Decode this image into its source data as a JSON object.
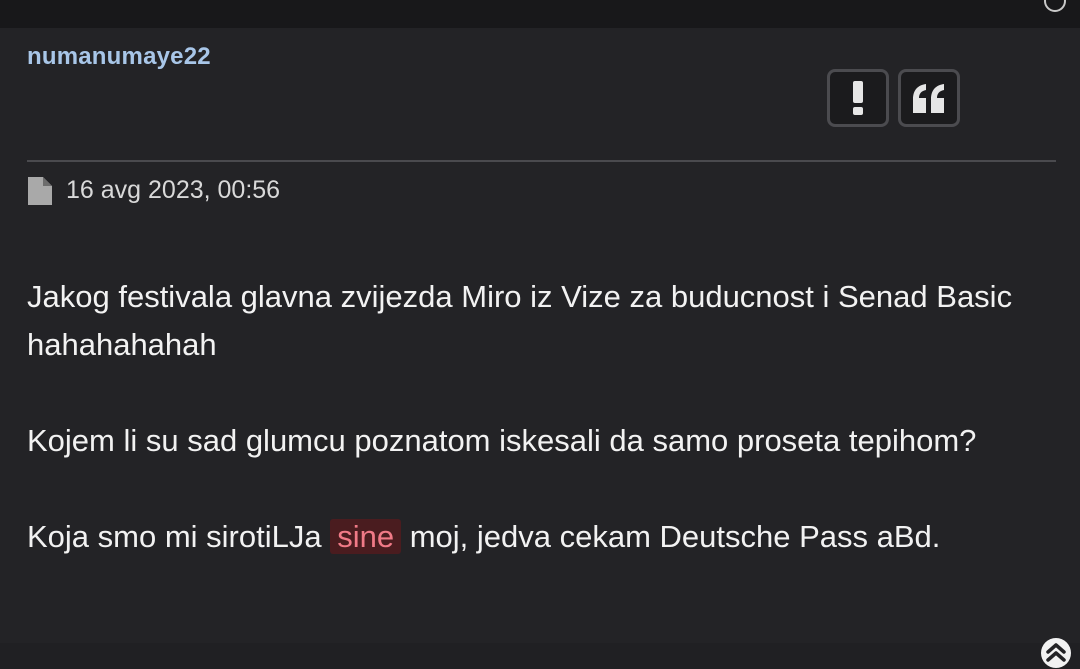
{
  "post": {
    "author": "numanumaye22",
    "timestamp": "16 avg 2023, 00:56",
    "actions": {
      "report_icon": "exclamation-icon",
      "quote_icon": "quote-icon"
    },
    "paragraphs": [
      "Jakog festivala glavna zvijezda Miro iz Vize za buducnost i Senad Basic hahahahahah",
      "Kojem li su sad glumcu poznatom iskesali da samo proseta tepihom?"
    ],
    "last_paragraph": {
      "before": "Koja smo mi sirotiLJa ",
      "highlight": "sine",
      "after": " moj, jedva cekam Deutsche Pass aBd."
    }
  },
  "colors": {
    "background": "#232326",
    "author": "#a8c6e8",
    "highlight_bg": "#4a1c1f",
    "highlight_text": "#f07a87"
  }
}
